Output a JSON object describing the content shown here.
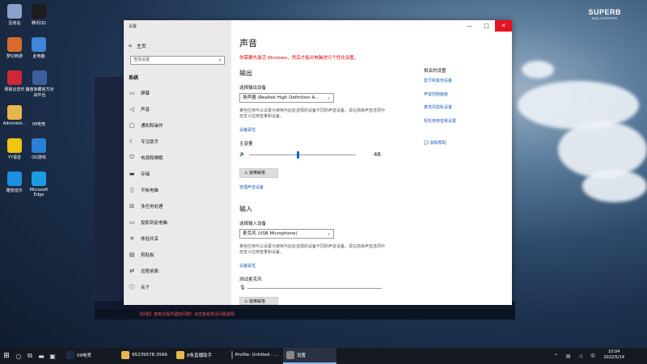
{
  "brand": {
    "line1": "SUPERB",
    "line2": "WALLPAPERS"
  },
  "desktop_icons": [
    {
      "label": "回收站",
      "color": "#8aa2c8"
    },
    {
      "label": "腾讯QQ",
      "color": "#1d1d1d"
    },
    {
      "label": "梦幻西游",
      "color": "#d86a2c"
    },
    {
      "label": "此电脑",
      "color": "#3d86d8"
    },
    {
      "label": "网易云音乐",
      "color": "#d0263a"
    },
    {
      "label": "魔兽争霸官方对战平台",
      "color": "#3a5f9a"
    },
    {
      "label": "Administr...",
      "color": "#e6b84b"
    },
    {
      "label": "09电竞",
      "color": "#1e2a4a"
    },
    {
      "label": "YY语音",
      "color": "#f1c40f"
    },
    {
      "label": "QQ游戏",
      "color": "#2a80d6"
    },
    {
      "label": "酷狗音乐",
      "color": "#1c8fe3"
    },
    {
      "label": "Microsoft Edge",
      "color": "#1b9de2"
    }
  ],
  "bg_window": {
    "status_text": "【秒框】使用过程中遇到问题？点击查看常见问题说明"
  },
  "settings": {
    "window_title": "设置",
    "home": "主页",
    "search_placeholder": "查找设置",
    "section": "系统",
    "nav": [
      {
        "icon": "monitor-icon",
        "glyph": "▭",
        "label": "屏幕"
      },
      {
        "icon": "speaker-icon",
        "glyph": "◁",
        "label": "声音"
      },
      {
        "icon": "notification-icon",
        "glyph": "▢",
        "label": "通知和操作"
      },
      {
        "icon": "moon-icon",
        "glyph": "☾",
        "label": "专注助手"
      },
      {
        "icon": "power-icon",
        "glyph": "⏻",
        "label": "电源和睡眠"
      },
      {
        "icon": "storage-icon",
        "glyph": "▬",
        "label": "存储"
      },
      {
        "icon": "tablet-icon",
        "glyph": "▯",
        "label": "平板电脑"
      },
      {
        "icon": "multitask-icon",
        "glyph": "⊟",
        "label": "多任务处理"
      },
      {
        "icon": "project-icon",
        "glyph": "▭",
        "label": "投影到此电脑"
      },
      {
        "icon": "share-icon",
        "glyph": "✕",
        "label": "体验共享"
      },
      {
        "icon": "clipboard-icon",
        "glyph": "▤",
        "label": "剪贴板"
      },
      {
        "icon": "remote-icon",
        "glyph": "⇄",
        "label": "远程桌面"
      },
      {
        "icon": "info-icon",
        "glyph": "ⓘ",
        "label": "关于"
      }
    ],
    "title": "声音",
    "warning": "你需要先激活 Windows，然后才能对电脑进行个性化设置。",
    "output": {
      "heading": "输出",
      "choose_label": "选择输出设备",
      "device": "扬声器 (Realtek High Definition A...",
      "desc": "某些应用可以设置为使用与此处选择的设备不同的声音设备。请在高级声音选项中自定义应用音量和设备。",
      "properties_link": "设备属性",
      "volume_label": "主音量",
      "volume": 46,
      "troubleshoot": "疑难解答",
      "manage_link": "管理声音设备"
    },
    "input": {
      "heading": "输入",
      "choose_label": "选择输入设备",
      "device": "麦克风 (USB Microphone)",
      "desc": "某些应用可以设置为使用与此处选择的设备不同的声音设备。请在高级声音选项中自定义应用音量和设备。",
      "properties_link": "设备属性",
      "test_label": "测试麦克风",
      "troubleshoot": "疑难解答"
    },
    "related": {
      "heading": "相关的设置",
      "links": [
        "蓝牙和其他设备",
        "声音控制面板",
        "麦克风隐私设置",
        "轻松使用音频设置"
      ],
      "help": "获取帮助"
    }
  },
  "taskbar": {
    "apps": [
      {
        "label": "09电竞",
        "color": "#1e2a4a",
        "active": false
      },
      {
        "label": "95239578-3566",
        "color": "#e6b84b",
        "active": false
      },
      {
        "label": "8条直播助手",
        "color": "#e6b84b",
        "active": false
      },
      {
        "label": "Profile: Untitled - ...",
        "color": "#666",
        "active": false
      },
      {
        "label": "设置",
        "color": "#888",
        "active": true
      }
    ],
    "time": "10:04",
    "date": "2022/5/14"
  },
  "colors": {
    "accent": "#0067c0",
    "warning": "#d00000",
    "close": "#e81123"
  }
}
